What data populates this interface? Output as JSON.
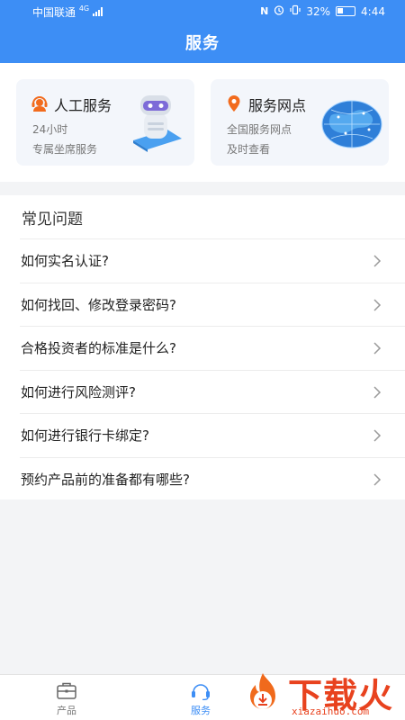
{
  "status_bar": {
    "carrier": "中国联通",
    "network": "4G",
    "battery": "32%",
    "time": "4:44"
  },
  "header": {
    "title": "服务"
  },
  "cards": [
    {
      "title": "人工服务",
      "line1": "24小时",
      "line2": "专属坐席服务",
      "icon": "customer-service-icon",
      "accent": "#f26b1d"
    },
    {
      "title": "服务网点",
      "line1": "全国服务网点",
      "line2": "及时查看",
      "icon": "location-pin-icon",
      "accent": "#f26b1d"
    }
  ],
  "faq": {
    "title": "常见问题",
    "items": [
      {
        "q": "如何实名认证?"
      },
      {
        "q": "如何找回、修改登录密码?"
      },
      {
        "q": "合格投资者的标准是什么?"
      },
      {
        "q": "如何进行风险测评?"
      },
      {
        "q": "如何进行银行卡绑定?"
      },
      {
        "q": "预约产品前的准备都有哪些?"
      }
    ]
  },
  "tabbar": {
    "tabs": [
      {
        "label": "产品",
        "icon": "briefcase-icon",
        "active": false
      },
      {
        "label": "服务",
        "icon": "headset-icon",
        "active": true
      }
    ]
  },
  "watermark": {
    "brand": "下载火",
    "url": "xiazaihuo.com"
  },
  "colors": {
    "primary": "#3d8ef5",
    "accent": "#f26b1d",
    "watermark": "#e8421e"
  }
}
